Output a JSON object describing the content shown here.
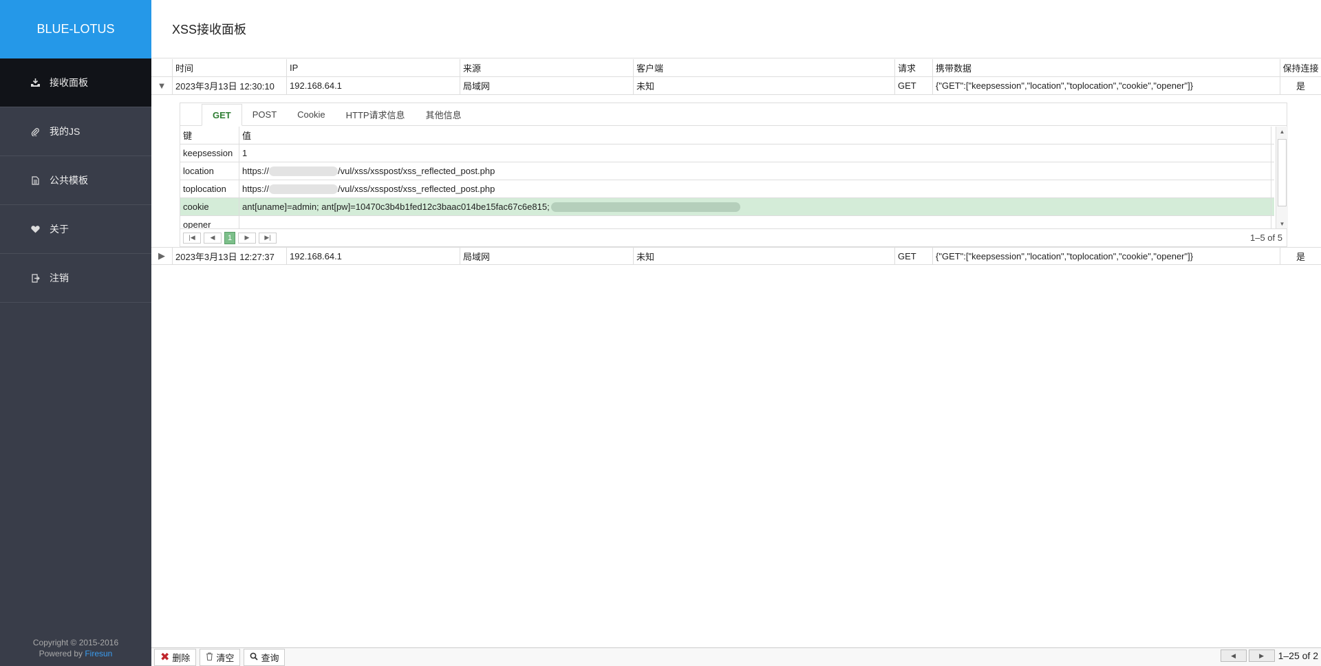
{
  "brand": "BLUE-LOTUS",
  "sidebar": {
    "items": [
      {
        "label": "接收面板",
        "icon": "download-icon"
      },
      {
        "label": "我的JS",
        "icon": "paperclip-icon"
      },
      {
        "label": "公共模板",
        "icon": "document-icon"
      },
      {
        "label": "关于",
        "icon": "heart-icon"
      },
      {
        "label": "注销",
        "icon": "logout-icon"
      }
    ],
    "copyright": "Copyright © 2015-2016",
    "powered_by": "Powered by",
    "powered_link": "Firesun"
  },
  "page": {
    "title": "XSS接收面板"
  },
  "grid": {
    "columns": [
      "时间",
      "IP",
      "来源",
      "客户端",
      "请求",
      "携带数据",
      "保持连接"
    ],
    "rows": [
      {
        "time": "2023年3月13日 12:30:10",
        "ip": "192.168.64.1",
        "source": "局域网",
        "client": "未知",
        "method": "GET",
        "data": "{\"GET\":[\"keepsession\",\"location\",\"toplocation\",\"cookie\",\"opener\"]}",
        "keep": "是"
      },
      {
        "time": "2023年3月13日 12:27:37",
        "ip": "192.168.64.1",
        "source": "局域网",
        "client": "未知",
        "method": "GET",
        "data": "{\"GET\":[\"keepsession\",\"location\",\"toplocation\",\"cookie\",\"opener\"]}",
        "keep": "是"
      }
    ]
  },
  "detail": {
    "tabs": [
      "GET",
      "POST",
      "Cookie",
      "HTTP请求信息",
      "其他信息"
    ],
    "header": {
      "key": "键",
      "value": "值"
    },
    "entries": [
      {
        "key": "keepsession",
        "value": "1"
      },
      {
        "key": "location",
        "value_prefix": "https://",
        "value_suffix": "/vul/xss/xsspost/xss_reflected_post.php"
      },
      {
        "key": "toplocation",
        "value_prefix": "https://",
        "value_suffix": "/vul/xss/xsspost/xss_reflected_post.php"
      },
      {
        "key": "cookie",
        "value": "ant[uname]=admin; ant[pw]=10470c3b4b1fed12c3baac014be15fac67c6e815;"
      },
      {
        "key": "opener",
        "value": ""
      }
    ],
    "pager": {
      "page": "1",
      "info": "1–5 of 5"
    }
  },
  "toolbar": {
    "delete": "删除",
    "clear": "清空",
    "search": "查询",
    "info": "1–25 of 2"
  },
  "colors": {
    "brand_bg": "#2598e8",
    "sidebar_bg": "#393d49",
    "active_nav": "#111318",
    "selected_row": "#d4ecd8"
  }
}
